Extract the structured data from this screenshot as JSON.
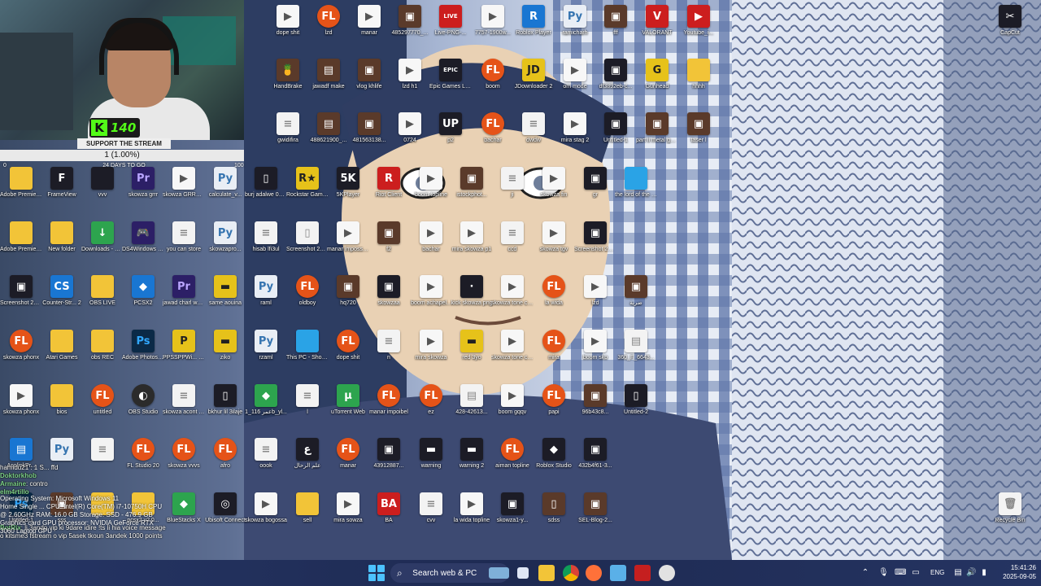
{
  "desktop": {
    "icons": [
      {
        "label": "dope shit",
        "kind": "vid",
        "glyph": "▶"
      },
      {
        "label": "lzd",
        "kind": "fl",
        "glyph": "FL"
      },
      {
        "label": "manar",
        "kind": "vid",
        "glyph": "▶"
      },
      {
        "label": "485297770_...",
        "kind": "img",
        "glyph": "▣"
      },
      {
        "label": "Live-PNG-...",
        "kind": "red",
        "glyph": "LIVE"
      },
      {
        "label": "7757-1900w...",
        "kind": "vid",
        "glyph": "▶"
      },
      {
        "label": "Roblox Player",
        "kind": "blue",
        "glyph": "R"
      },
      {
        "label": "ramicharh",
        "kind": "py",
        "glyph": "Py"
      },
      {
        "label": "fff",
        "kind": "img",
        "glyph": "▣"
      },
      {
        "label": "VALORANT",
        "kind": "red",
        "glyph": "V"
      },
      {
        "label": "Youtube_i...",
        "kind": "red",
        "glyph": "▶"
      },
      {
        "label": "HandBrake",
        "kind": "img",
        "glyph": "🍍"
      },
      {
        "label": "jawadf make",
        "kind": "img",
        "glyph": "▤"
      },
      {
        "label": "vlog khlife",
        "kind": "img",
        "glyph": "▣"
      },
      {
        "label": "lzd h1",
        "kind": "vid",
        "glyph": "▶"
      },
      {
        "label": "Epic Games Launcher",
        "kind": "dark",
        "glyph": "EPIC"
      },
      {
        "label": "boom",
        "kind": "fl",
        "glyph": "FL"
      },
      {
        "label": "JDownloader 2",
        "kind": "yellow",
        "glyph": "JD"
      },
      {
        "label": "om mode",
        "kind": "vid",
        "glyph": "▶"
      },
      {
        "label": "df3892eb-c...",
        "kind": "dark",
        "glyph": "▣"
      },
      {
        "label": "Gunhead",
        "kind": "yellow",
        "glyph": "G"
      },
      {
        "label": "hhhh",
        "kind": "fold",
        "glyph": ""
      },
      {
        "label": "gwidifira",
        "kind": "file",
        "glyph": "≡"
      },
      {
        "label": "488621900_...",
        "kind": "img",
        "glyph": "▤"
      },
      {
        "label": "481563138...",
        "kind": "img",
        "glyph": "▣"
      },
      {
        "label": "0724",
        "kind": "vid",
        "glyph": "▶"
      },
      {
        "label": "p2",
        "kind": "dark",
        "glyph": "UP"
      },
      {
        "label": "bachar",
        "kind": "fl",
        "glyph": "FL"
      },
      {
        "label": "dwdw",
        "kind": "file",
        "glyph": "≡"
      },
      {
        "label": "mira stag 2",
        "kind": "vid",
        "glyph": "▶"
      },
      {
        "label": "Untitled-1",
        "kind": "dark",
        "glyph": "▣"
      },
      {
        "label": "part ii metal gear solid...",
        "kind": "img",
        "glyph": "▣"
      },
      {
        "label": "taser l",
        "kind": "img",
        "glyph": "▣"
      },
      {
        "label": "Adobe Premiere P...",
        "kind": "fold",
        "glyph": ""
      },
      {
        "label": "FrameView",
        "kind": "dark",
        "glyph": "F"
      },
      {
        "label": "vvv",
        "kind": "dark",
        "glyph": ""
      },
      {
        "label": "skowza grrr",
        "kind": "pr",
        "glyph": "Pr"
      },
      {
        "label": "skowza GRRR no adlibs",
        "kind": "vid",
        "glyph": "▶"
      },
      {
        "label": "calculate_v...",
        "kind": "py",
        "glyph": "Py"
      },
      {
        "label": "burj adalwe 02l2025",
        "kind": "dark",
        "glyph": "▯"
      },
      {
        "label": "Rockstar Games...",
        "kind": "yellow",
        "glyph": "R★"
      },
      {
        "label": "5KPlayer",
        "kind": "dark",
        "glyph": "5K"
      },
      {
        "label": "Riot Client",
        "kind": "red",
        "glyph": "R"
      },
      {
        "label": "boom topline",
        "kind": "vid",
        "glyph": "▶"
      },
      {
        "label": "istockphot...",
        "kind": "img",
        "glyph": "▣"
      },
      {
        "label": "ji",
        "kind": "file",
        "glyph": "≡"
      },
      {
        "label": "skowza fin",
        "kind": "vid",
        "glyph": "▶"
      },
      {
        "label": "gr",
        "kind": "dark",
        "glyph": "▣"
      },
      {
        "label": "the lord of the rings p...",
        "kind": "pc",
        "glyph": ""
      },
      {
        "label": "Adobe Premiere P...",
        "kind": "fold",
        "glyph": ""
      },
      {
        "label": "New folder",
        "kind": "fold",
        "glyph": ""
      },
      {
        "label": "Downloads - Shortcut",
        "kind": "green",
        "glyph": "↓"
      },
      {
        "label": "DS4Windows - Shortcut",
        "kind": "pr",
        "glyph": "🎮"
      },
      {
        "label": "you can store",
        "kind": "file",
        "glyph": "≡"
      },
      {
        "label": "skowzapro...",
        "kind": "py",
        "glyph": "Py"
      },
      {
        "label": "hisab lfi3ul",
        "kind": "file",
        "glyph": "≡"
      },
      {
        "label": "Screenshot 2025-02-...",
        "kind": "file",
        "glyph": "▯"
      },
      {
        "label": "manar impossibel",
        "kind": "vid",
        "glyph": "▶"
      },
      {
        "label": "f2",
        "kind": "img",
        "glyph": "▣"
      },
      {
        "label": "bachar",
        "kind": "vid",
        "glyph": "▶"
      },
      {
        "label": "mira skowza p1",
        "kind": "vid",
        "glyph": "▶"
      },
      {
        "label": "ccd",
        "kind": "file",
        "glyph": "≡"
      },
      {
        "label": "skowza tgv",
        "kind": "vid",
        "glyph": "▶"
      },
      {
        "label": "Screenshot 2025-08-...",
        "kind": "dark",
        "glyph": "▣"
      },
      {
        "label": "Screenshot 2025-09-...",
        "kind": "dark",
        "glyph": "▣"
      },
      {
        "label": "Counter-Str... 2",
        "kind": "blue",
        "glyph": "CS"
      },
      {
        "label": "OBS LIVE",
        "kind": "fold",
        "glyph": ""
      },
      {
        "label": "PCSX2",
        "kind": "blue",
        "glyph": "◆"
      },
      {
        "label": "jawad charl wasf nabie",
        "kind": "pr",
        "glyph": "Pr"
      },
      {
        "label": "same aouina",
        "kind": "yellow",
        "glyph": "▬"
      },
      {
        "label": "raml",
        "kind": "py",
        "glyph": "Py"
      },
      {
        "label": "oldboy",
        "kind": "fl",
        "glyph": "FL"
      },
      {
        "label": "hq720",
        "kind": "img",
        "glyph": "▣"
      },
      {
        "label": "skowzaa",
        "kind": "dark",
        "glyph": "▣"
      },
      {
        "label": "boom achapel...",
        "kind": "vid",
        "glyph": "▶"
      },
      {
        "label": "kick skowza png",
        "kind": "dark",
        "glyph": "·"
      },
      {
        "label": "skowza tone coverffff_1",
        "kind": "vid",
        "glyph": "▶"
      },
      {
        "label": "la wida",
        "kind": "fl",
        "glyph": "FL"
      },
      {
        "label": "lzd",
        "kind": "vid",
        "glyph": "▶"
      },
      {
        "label": "ضربة",
        "kind": "img",
        "glyph": "▣"
      },
      {
        "label": "skowza phonx",
        "kind": "fl",
        "glyph": "FL"
      },
      {
        "label": "Atari Games",
        "kind": "fold",
        "glyph": ""
      },
      {
        "label": "obs REC",
        "kind": "fold",
        "glyph": ""
      },
      {
        "label": "Adobe Photosh...",
        "kind": "ps",
        "glyph": "Ps"
      },
      {
        "label": "PPSSPPWi... - Shortcut",
        "kind": "yellow",
        "glyph": "P"
      },
      {
        "label": "ziko",
        "kind": "yellow",
        "glyph": "▬"
      },
      {
        "label": "rzaml",
        "kind": "py",
        "glyph": "Py"
      },
      {
        "label": "This PC - Shortcut",
        "kind": "pc",
        "glyph": ""
      },
      {
        "label": "dope shit",
        "kind": "fl",
        "glyph": "FL"
      },
      {
        "label": "n",
        "kind": "file",
        "glyph": "≡"
      },
      {
        "label": "mira skowza",
        "kind": "vid",
        "glyph": "▶"
      },
      {
        "label": "red 3yo",
        "kind": "yellow",
        "glyph": "▬"
      },
      {
        "label": "skowza tone coverffff",
        "kind": "vid",
        "glyph": "▶"
      },
      {
        "label": "mira",
        "kind": "fl",
        "glyph": "FL"
      },
      {
        "label": "boom sko",
        "kind": "vid",
        "glyph": "▶"
      },
      {
        "label": "360_F_6643...",
        "kind": "file",
        "glyph": "▤"
      },
      {
        "label": "skowza phonx",
        "kind": "vid",
        "glyph": "▶"
      },
      {
        "label": "bios",
        "kind": "fold",
        "glyph": ""
      },
      {
        "label": "untitled",
        "kind": "fl",
        "glyph": "FL"
      },
      {
        "label": "OBS Studio",
        "kind": "obs",
        "glyph": "◐"
      },
      {
        "label": "skowza acont systme",
        "kind": "file",
        "glyph": "≡"
      },
      {
        "label": "bkhur lil 3ilaje",
        "kind": "dark",
        "glyph": "▯"
      },
      {
        "label": "عمر 116_1b_yl...",
        "kind": "green",
        "glyph": "◆"
      },
      {
        "label": "l",
        "kind": "file",
        "glyph": "≡"
      },
      {
        "label": "uTorrent Web",
        "kind": "green",
        "glyph": "µ"
      },
      {
        "label": "manar impoibel",
        "kind": "fl",
        "glyph": "FL"
      },
      {
        "label": "ez",
        "kind": "fl",
        "glyph": "FL"
      },
      {
        "label": "428-42613...",
        "kind": "file",
        "glyph": "▤"
      },
      {
        "label": "boom gqqv",
        "kind": "vid",
        "glyph": "▶"
      },
      {
        "label": "papi",
        "kind": "fl",
        "glyph": "FL"
      },
      {
        "label": "96b43c8...",
        "kind": "img",
        "glyph": "▣"
      },
      {
        "label": "Untitled-2",
        "kind": "dark",
        "glyph": "▯"
      },
      {
        "label": "AsolinkPr...",
        "kind": "blue",
        "glyph": "▤"
      },
      {
        "label": "",
        "kind": "py",
        "glyph": "Py"
      },
      {
        "label": "",
        "kind": "file",
        "glyph": "≡"
      },
      {
        "label": "FL Studio 20",
        "kind": "fl",
        "glyph": "FL"
      },
      {
        "label": "skowza vvvs",
        "kind": "fl",
        "glyph": "FL"
      },
      {
        "label": "afro",
        "kind": "fl",
        "glyph": "FL"
      },
      {
        "label": "oook",
        "kind": "file",
        "glyph": "≡"
      },
      {
        "label": "علم الرحال",
        "kind": "dark",
        "glyph": "ع"
      },
      {
        "label": "manar",
        "kind": "fl",
        "glyph": "FL"
      },
      {
        "label": "43912887...",
        "kind": "dark",
        "glyph": "▣"
      },
      {
        "label": "warning",
        "kind": "dark",
        "glyph": "▬"
      },
      {
        "label": "warning 2",
        "kind": "dark",
        "glyph": "▬"
      },
      {
        "label": "aiman topline",
        "kind": "fl",
        "glyph": "FL"
      },
      {
        "label": "Roblox Studio",
        "kind": "dark",
        "glyph": "◆"
      },
      {
        "label": "432b4f61-3...",
        "kind": "dark",
        "glyph": "▣"
      },
      {
        "label": "Untitled-1",
        "kind": "ps",
        "glyph": "Ps"
      },
      {
        "label": "sss",
        "kind": "img",
        "glyph": "▣"
      },
      {
        "label": "",
        "kind": "fold",
        "glyph": ""
      },
      {
        "label": "pcsx2 v2.0...",
        "kind": "fold",
        "glyph": ""
      },
      {
        "label": "BlueStacks X",
        "kind": "green",
        "glyph": "◆"
      },
      {
        "label": "Ubisoft Connect",
        "kind": "dark",
        "glyph": "◎"
      },
      {
        "label": "skowza bogossa",
        "kind": "vid",
        "glyph": "▶"
      },
      {
        "label": "sell",
        "kind": "fold",
        "glyph": ""
      },
      {
        "label": "mira sowza",
        "kind": "vid",
        "glyph": "▶"
      },
      {
        "label": "BA",
        "kind": "red",
        "glyph": "BA"
      },
      {
        "label": "cvv",
        "kind": "file",
        "glyph": "≡"
      },
      {
        "label": "la wida topline",
        "kind": "vid",
        "glyph": "▶"
      },
      {
        "label": "skowza1-y...",
        "kind": "dark",
        "glyph": "▣"
      },
      {
        "label": "sdss",
        "kind": "img",
        "glyph": "▯"
      },
      {
        "label": "SEL-Blog-2...",
        "kind": "img",
        "glyph": "▣"
      },
      {
        "label": "CapCut",
        "kind": "dark",
        "glyph": "✂"
      },
      {
        "label": "Recycle Bin",
        "kind": "file",
        "glyph": "🗑"
      }
    ]
  },
  "webcam": {
    "kick_count": "140",
    "kick_logo": "K"
  },
  "support": {
    "title": "SUPPORT THE STREAM",
    "progress_text": "1 (1.00%)",
    "progress": 0.01,
    "days_text": "24 DAYS TO GO",
    "min": "0",
    "max": "100"
  },
  "chat": {
    "messages": [
      {
        "user": "",
        "text": "hamidu21 : 1 S... ffd"
      },
      {
        "user": "Doktorkhob",
        "text": ""
      },
      {
        "user": "Armaine",
        "text": ": contro"
      },
      {
        "user": "",
        "text": ""
      },
      {
        "user": "",
        "text": ""
      },
      {
        "user": "",
        "text": ""
      },
      {
        "user": "",
        "text": ""
      },
      {
        "user": "",
        "text": ""
      },
      {
        "user": "elm4rtillo",
        "text": ""
      },
      {
        "user": "BotRix",
        "text": ": li 3ando vip ki 9dare idire !ts li hia voice message o kitsme3 fstream o vip 5asek tkoun 3andek 1000 points"
      }
    ]
  },
  "sysinfo": {
    "lines": [
      "Operating System: Microsoft Windows 11",
      "Home Single ... CPU: Intel(R) Core(TM) i7-10750H CPU",
      "@ 2.60GHz RAM: 16.0 GB Storage: SSD - 476.9 GB",
      "Graphics card GPU processor: NVIDIA GeForce RTX",
      "3060 Laptop GPU"
    ]
  },
  "taskbar": {
    "search_placeholder": "Search web & PC",
    "lang": "ENG",
    "time": "15:41:26",
    "date": "2025-09-05",
    "accent": "#4cc2ff"
  }
}
